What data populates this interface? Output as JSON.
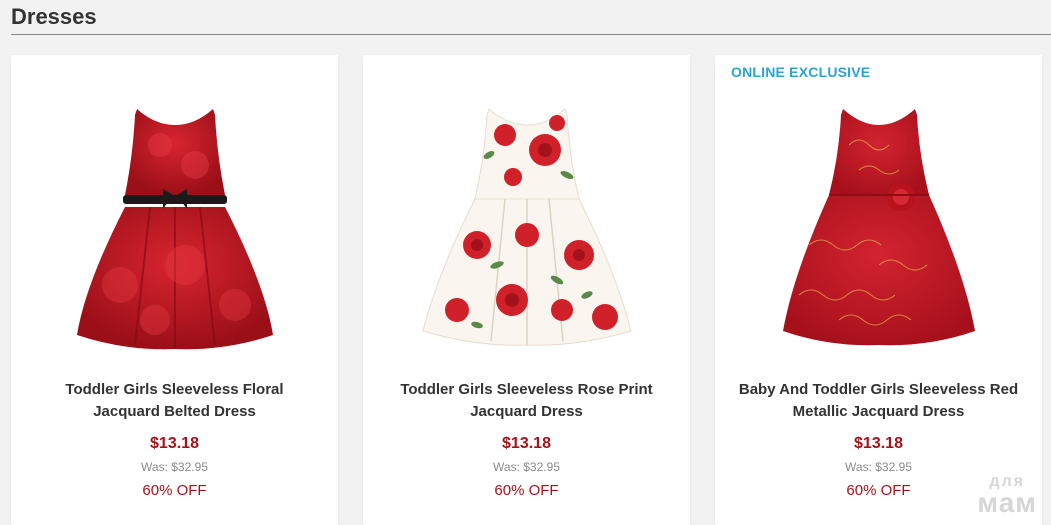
{
  "section": {
    "title": "Dresses"
  },
  "products": [
    {
      "badge": "",
      "name": "Toddler Girls Sleeveless Floral Jacquard Belted Dress",
      "price": "$13.18",
      "was": "Was: $32.95",
      "discount": "60% OFF",
      "image": "red-jacquard-belted-dress"
    },
    {
      "badge": "",
      "name": "Toddler Girls Sleeveless Rose Print Jacquard Dress",
      "price": "$13.18",
      "was": "Was: $32.95",
      "discount": "60% OFF",
      "image": "white-rose-print-dress"
    },
    {
      "badge": "ONLINE EXCLUSIVE",
      "name": "Baby And Toddler Girls Sleeveless Red Metallic Jacquard Dress",
      "price": "$13.18",
      "was": "Was: $32.95",
      "discount": "60% OFF",
      "image": "red-metallic-jacquard-dress"
    }
  ],
  "watermark": {
    "line1": "для",
    "line2": "мам"
  },
  "colors": {
    "price": "#a7131b",
    "badge": "#2aa3d6",
    "dress_red": "#c01a24",
    "rose_red": "#d0212b",
    "dress_white": "#faf6ef",
    "leaf_green": "#5a8a4a"
  }
}
